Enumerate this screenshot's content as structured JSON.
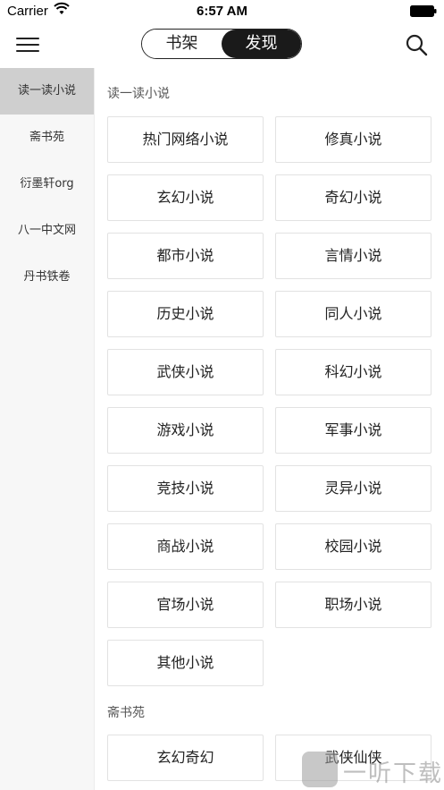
{
  "status_bar": {
    "carrier": "Carrier",
    "time": "6:57 AM"
  },
  "nav": {
    "tabs": [
      "书架",
      "发现"
    ],
    "active_tab": "发现"
  },
  "sidebar": {
    "items": [
      "读一读小说",
      "斋书苑",
      "衍墨轩org",
      "八一中文网",
      "丹书铁卷"
    ],
    "active_index": 0
  },
  "sections": [
    {
      "title": "读一读小说",
      "items": [
        "热门网络小说",
        "修真小说",
        "玄幻小说",
        "奇幻小说",
        "都市小说",
        "言情小说",
        "历史小说",
        "同人小说",
        "武侠小说",
        "科幻小说",
        "游戏小说",
        "军事小说",
        "竞技小说",
        "灵异小说",
        "商战小说",
        "校园小说",
        "官场小说",
        "职场小说",
        "其他小说"
      ]
    },
    {
      "title": "斋书苑",
      "items": [
        "玄幻奇幻",
        "武侠仙侠"
      ]
    }
  ],
  "watermark": {
    "text": "一听下载"
  }
}
